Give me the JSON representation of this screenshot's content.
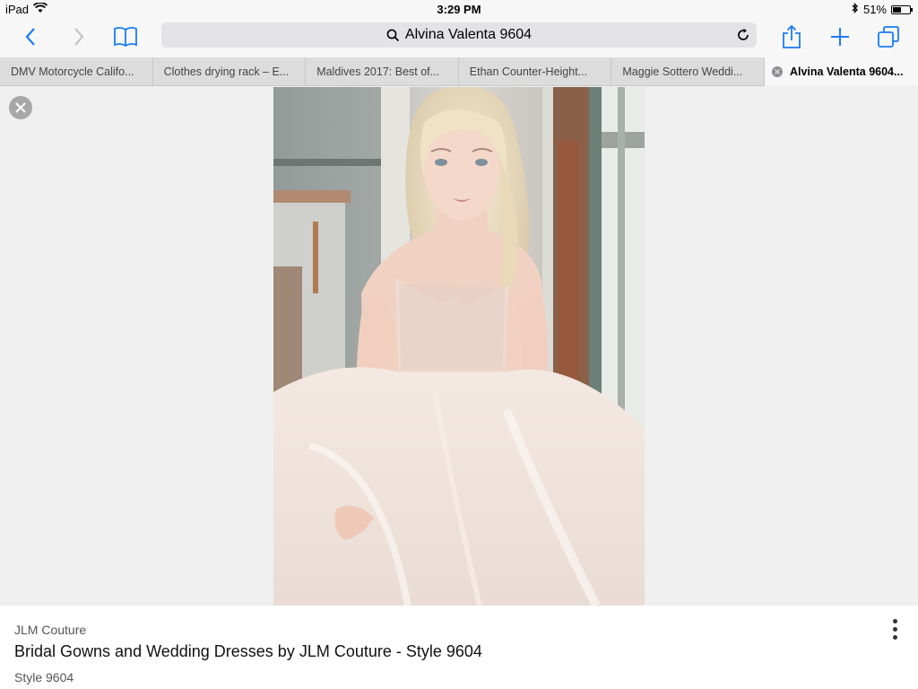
{
  "status_bar": {
    "device": "iPad",
    "time": "3:29 PM",
    "battery_text": "51%",
    "battery_level": 0.51
  },
  "toolbar": {
    "url_text": "Alvina Valenta 9604"
  },
  "tabs": [
    {
      "label": "DMV Motorcycle Califo..."
    },
    {
      "label": "Clothes drying rack – E..."
    },
    {
      "label": "Maldives 2017: Best of..."
    },
    {
      "label": "Ethan Counter-Height..."
    },
    {
      "label": "Maggie Sottero Weddi..."
    },
    {
      "label": "Alvina Valenta 9604...",
      "active": true
    }
  ],
  "caption": {
    "source": "JLM Couture",
    "title": "Bridal Gowns and Wedding Dresses by JLM Couture - Style 9604",
    "subtitle": "Style 9604"
  },
  "colors": {
    "accent": "#1a7cf5"
  }
}
